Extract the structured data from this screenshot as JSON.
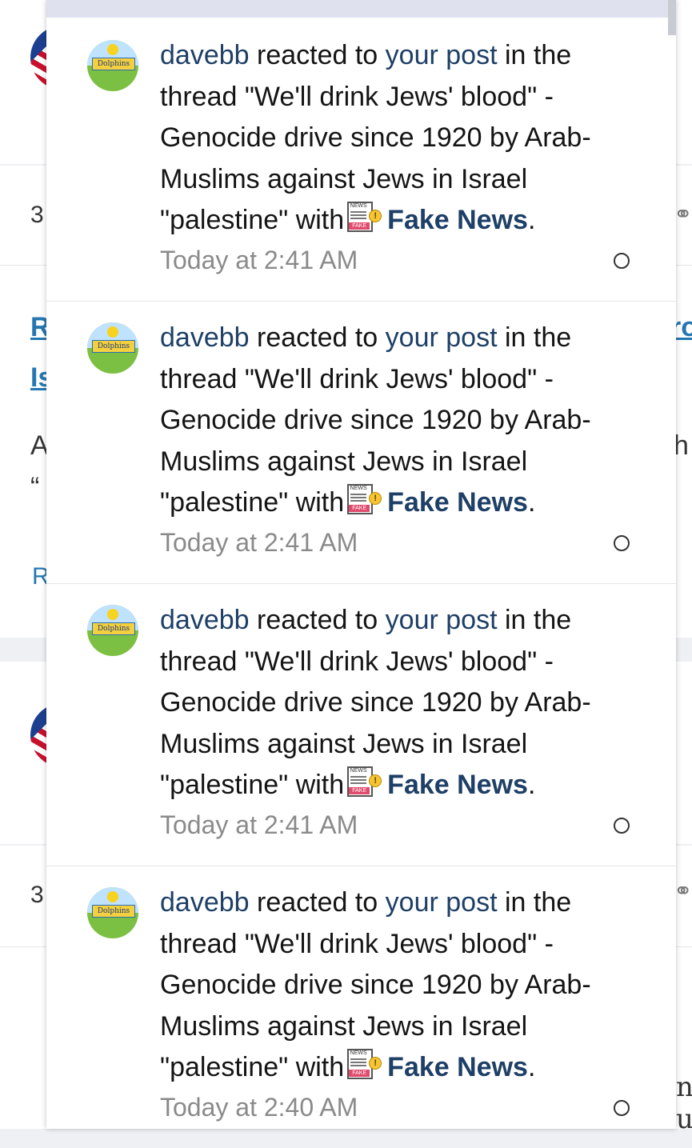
{
  "background": {
    "counts": [
      "3",
      "3"
    ],
    "link_fragments": [
      "R",
      "Is",
      "ro"
    ],
    "text_fragments": [
      "A",
      "“",
      "R",
      "h",
      "n",
      "u"
    ]
  },
  "notifications": [
    {
      "user": "davebb",
      "action": "reacted to",
      "object_link": "your post",
      "thread_intro": "in the thread",
      "thread_title": "\"We'll drink Jews' blood\" - Genocide drive since 1920 by Arab-Muslims against Jews in Israel \"palestine\"",
      "with_word": "with",
      "reaction": "Fake News",
      "reaction_icon": "fake-news-icon",
      "period": ".",
      "time": "Today at 2:41 AM"
    },
    {
      "user": "davebb",
      "action": "reacted to",
      "object_link": "your post",
      "thread_intro": "in the thread",
      "thread_title": "\"We'll drink Jews' blood\" - Genocide drive since 1920 by Arab-Muslims against Jews in Israel \"palestine\"",
      "with_word": "with",
      "reaction": "Fake News",
      "reaction_icon": "fake-news-icon",
      "period": ".",
      "time": "Today at 2:41 AM"
    },
    {
      "user": "davebb",
      "action": "reacted to",
      "object_link": "your post",
      "thread_intro": "in the thread",
      "thread_title": "\"We'll drink Jews' blood\" - Genocide drive since 1920 by Arab-Muslims against Jews in Israel \"palestine\"",
      "with_word": "with",
      "reaction": "Fake News",
      "reaction_icon": "fake-news-icon",
      "period": ".",
      "time": "Today at 2:41 AM"
    },
    {
      "user": "davebb",
      "action": "reacted to",
      "object_link": "your post",
      "thread_intro": "in the thread",
      "thread_title": "\"We'll drink Jews' blood\" - Genocide drive since 1920 by Arab-Muslims against Jews in Israel \"palestine\"",
      "with_word": "with",
      "reaction": "Fake News",
      "reaction_icon": "fake-news-icon",
      "period": ".",
      "time": "Today at 2:40 AM"
    }
  ],
  "avatar_banner_text": "Dolphins",
  "news_icon_text": {
    "top": "NEWS",
    "stamp": "FAKE",
    "alert": "!"
  },
  "colors": {
    "link": "#1e3f66",
    "time": "#8a8a8a",
    "popup_header": "#dfe1ee",
    "avatar_green": "#7cc043"
  }
}
